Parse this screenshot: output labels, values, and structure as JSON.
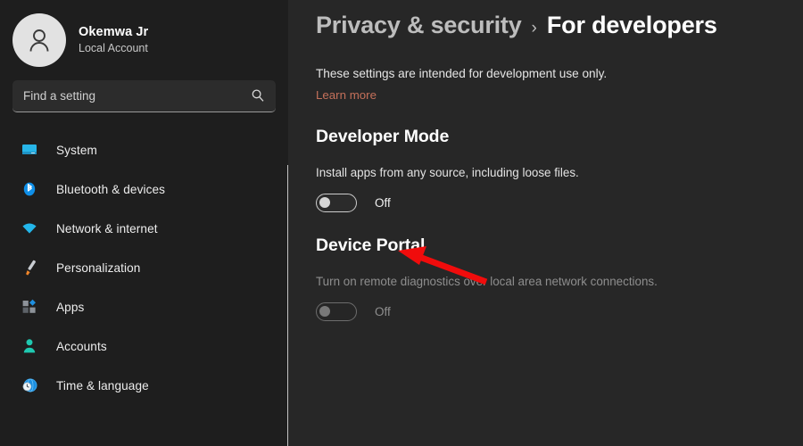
{
  "sidebar": {
    "profile": {
      "name": "Okemwa Jr",
      "account_type": "Local Account",
      "avatar_icon": "person-avatar-icon"
    },
    "search": {
      "placeholder": "Find a setting",
      "value": "",
      "icon": "search-icon"
    },
    "items": [
      {
        "label": "System",
        "icon": "monitor-icon"
      },
      {
        "label": "Bluetooth & devices",
        "icon": "bluetooth-icon"
      },
      {
        "label": "Network & internet",
        "icon": "wifi-icon"
      },
      {
        "label": "Personalization",
        "icon": "paintbrush-icon"
      },
      {
        "label": "Apps",
        "icon": "apps-grid-icon"
      },
      {
        "label": "Accounts",
        "icon": "person-icon"
      },
      {
        "label": "Time & language",
        "icon": "clock-globe-icon"
      }
    ]
  },
  "content": {
    "breadcrumb": {
      "parent": "Privacy & security",
      "separator": "›",
      "current": "For developers"
    },
    "intro_text": "These settings are intended for development use only.",
    "learn_more": "Learn more",
    "sections": [
      {
        "title": "Developer Mode",
        "description": "Install apps from any source, including loose files.",
        "toggle_state": "Off",
        "enabled": true
      },
      {
        "title": "Device Portal",
        "description": "Turn on remote diagnostics over local area network connections.",
        "toggle_state": "Off",
        "enabled": false
      }
    ]
  },
  "annotation": {
    "type": "arrow",
    "color": "#f00c0c",
    "points_at": "developer-mode-toggle"
  },
  "colors": {
    "sidebar_bg": "#1e1e1e",
    "content_bg": "#272727",
    "link": "#c4705a",
    "accent_arrow": "#f00c0c"
  }
}
